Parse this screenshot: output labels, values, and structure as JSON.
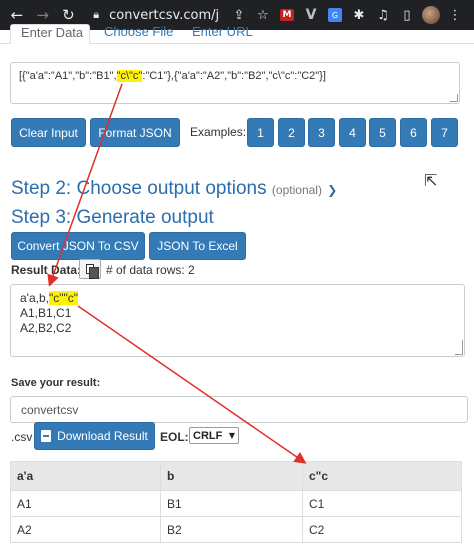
{
  "browser": {
    "url": "convertcsv.com/jso",
    "ellipsis": "...",
    "ext_red_label": "M",
    "ext_v_label": "V",
    "ext_blue_label": "G"
  },
  "tabs": [
    {
      "label": "Enter Data"
    },
    {
      "label": "Choose File"
    },
    {
      "label": "Enter URL"
    }
  ],
  "input": {
    "prefix": "[{\"a'a\":\"A1\",\"b\":\"B1\",",
    "highlight": "\"c\\\"c\"",
    "suffix": ":\"C1\"},{\"a'a\":\"A2\",\"b\":\"B2\",\"c\\\"c\":\"C2\"}]"
  },
  "buttons": {
    "clear": "Clear Input",
    "format": "Format JSON",
    "examples_label": "Examples:",
    "examples": [
      "1",
      "2",
      "3",
      "4",
      "5",
      "6",
      "7"
    ],
    "to_csv": "Convert JSON To CSV",
    "to_excel": "JSON To Excel",
    "download": "Download Result"
  },
  "steps": {
    "step2": "Step 2: Choose output options",
    "step2_optional": "(optional)",
    "step3": "Step 3: Generate output"
  },
  "result": {
    "label": "Result Data:",
    "rows_label": "# of data rows: 2",
    "line1_prefix": "a'a,b,",
    "line1_highlight": "\"c\"\"c\"",
    "line2": "A1,B1,C1",
    "line3": "A2,B2,C2"
  },
  "save": {
    "label": "Save your result:",
    "filename": "convertcsv",
    "extension": ".csv",
    "eol_label": "EOL:",
    "eol_value": "CRLF"
  },
  "table": {
    "headers": [
      "a'a",
      "b",
      "c\"c"
    ],
    "rows": [
      [
        "A1",
        "B1",
        "C1"
      ],
      [
        "A2",
        "B2",
        "C2"
      ]
    ]
  },
  "colors": {
    "accent": "#337ab7",
    "highlight": "#fff200",
    "arrow": "#e0302a"
  }
}
